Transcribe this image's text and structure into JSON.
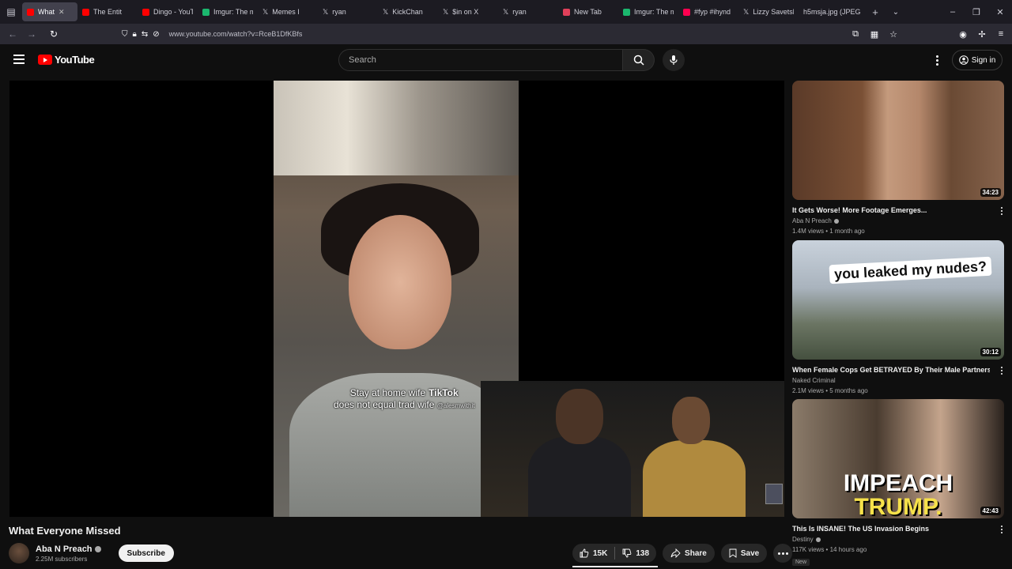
{
  "browser": {
    "tabs": [
      {
        "label": "What",
        "active": true,
        "color": "#ff0000"
      },
      {
        "label": "The Entit",
        "active": false,
        "color": "#ff0000"
      },
      {
        "label": "Dingo - YouT",
        "active": false,
        "color": "#ff0000"
      },
      {
        "label": "Imgur: The m",
        "active": false,
        "color": "#1bb76e"
      },
      {
        "label": "Memes I",
        "active": false,
        "color": "#ffffff"
      },
      {
        "label": "ryan",
        "active": false,
        "color": "#ffffff"
      },
      {
        "label": "KickChan",
        "active": false,
        "color": "#ffffff"
      },
      {
        "label": "$in on X",
        "active": false,
        "color": "#ffffff"
      },
      {
        "label": "ryan",
        "active": false,
        "color": "#ffffff"
      },
      {
        "label": "New Tab",
        "active": false,
        "color": "#e0405a"
      },
      {
        "label": "Imgur: The m",
        "active": false,
        "color": "#1bb76e"
      },
      {
        "label": "#fyp #ihynd",
        "active": false,
        "color": "#ff0050"
      },
      {
        "label": "Lizzy Savetsk",
        "active": false,
        "color": "#ffffff"
      },
      {
        "label": "h5msja.jpg (JPEG",
        "active": false,
        "color": "#888888"
      }
    ],
    "url": "www.youtube.com/watch?v=RceB1DfKBfs"
  },
  "masthead": {
    "logo_text": "YouTube",
    "search_placeholder": "Search",
    "signin_label": "Sign in"
  },
  "player": {
    "caption_line1": "Stay at home wife",
    "caption_brand": "TikTok",
    "caption_line2": "does not equal trad wife",
    "caption_handle": "@alesmwithit"
  },
  "video": {
    "title": "What Everyone Missed",
    "channel": "Aba N Preach",
    "subscribers": "2.25M subscribers",
    "subscribe_label": "Subscribe",
    "likes": "15K",
    "dislikes": "138",
    "share_label": "Share",
    "save_label": "Save"
  },
  "recommendations": [
    {
      "title": "It Gets Worse! More Footage Emerges...",
      "channel": "Aba N Preach",
      "verified": true,
      "meta": "1.4M views • 1 month ago",
      "duration": "34:23",
      "thumb_text": ""
    },
    {
      "title": "When Female Cops Get BETRAYED By Their Male Partners",
      "channel": "Naked Criminal",
      "verified": false,
      "meta": "2.1M views • 5 months ago",
      "duration": "30:12",
      "thumb_text": "you leaked my nudes?"
    },
    {
      "title": "This Is INSANE! The US Invasion Begins",
      "channel": "Destiny",
      "verified": true,
      "meta": "117K views • 14 hours ago",
      "duration": "42:43",
      "badge": "New",
      "thumb_text_1": "IMPEACH",
      "thumb_text_2": "TRUMP."
    }
  ],
  "colors": {
    "background": "#0f0f0f",
    "brand_red": "#ff0000",
    "pill_bg": "#272727",
    "text_secondary": "#aaaaaa"
  }
}
